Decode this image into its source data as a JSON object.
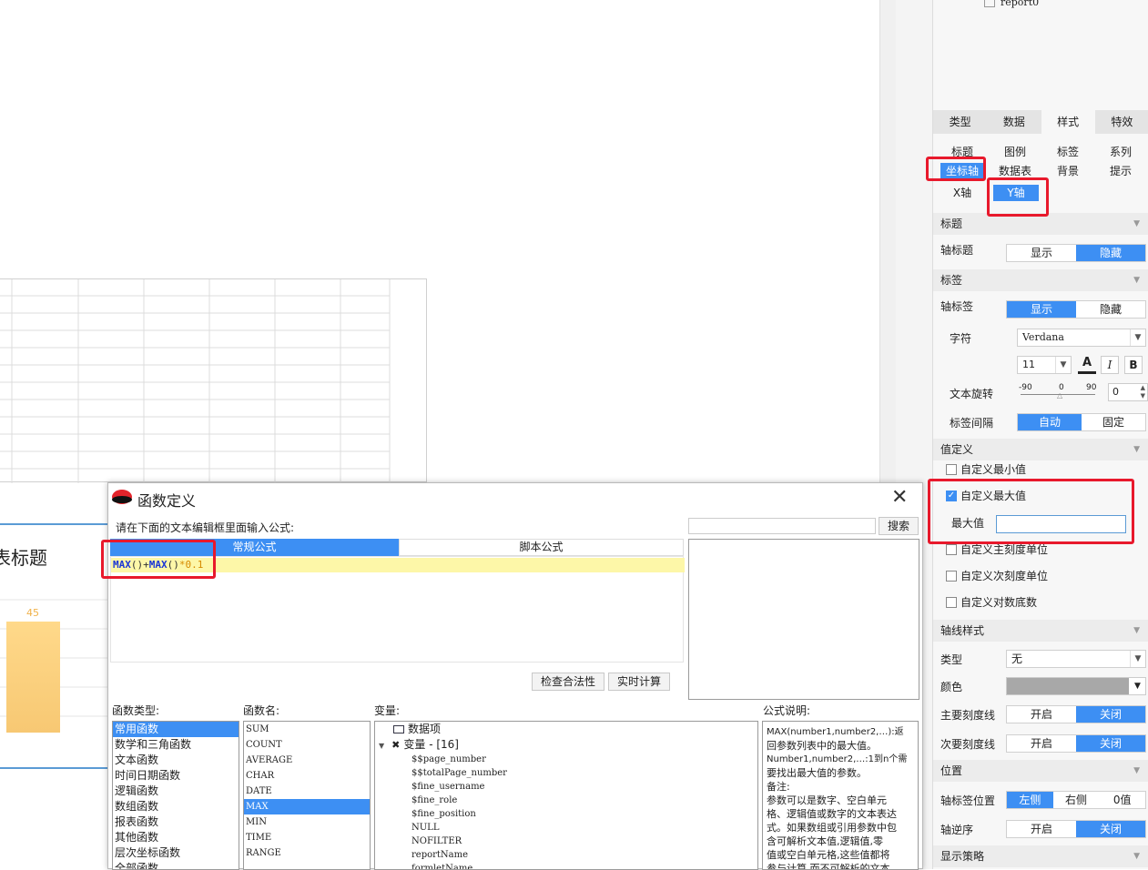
{
  "chart_preview": {
    "title": "表标题",
    "bar_label": "45",
    "bar_value": 45
  },
  "panel": {
    "tree_item": "report0",
    "main_tabs": [
      "类型",
      "数据",
      "样式",
      "特效"
    ],
    "sub_tabs_row1": [
      "标题",
      "图例",
      "标签",
      "系列"
    ],
    "sub_tabs_row2": [
      "坐标轴",
      "数据表",
      "背景",
      "提示"
    ],
    "axis_tabs": [
      "X轴",
      "Y轴"
    ],
    "sections": {
      "title": "标题",
      "label": "标签",
      "value_def": "值定义",
      "axis_style": "轴线样式",
      "position": "位置",
      "display_strategy": "显示策略"
    },
    "axis_title": {
      "label": "轴标题",
      "show": "显示",
      "hide": "隐藏"
    },
    "axis_label": {
      "label": "轴标签",
      "show": "显示",
      "hide": "隐藏"
    },
    "font": {
      "label": "字符",
      "family": "Verdana",
      "size": "11",
      "bold": "B",
      "italic": "I",
      "color": "A"
    },
    "rotation": {
      "label": "文本旋转",
      "min": "-90",
      "mid": "0",
      "max": "90",
      "value": "0"
    },
    "interval": {
      "label": "标签间隔",
      "auto": "自动",
      "fixed": "固定"
    },
    "custom_min": "自定义最小值",
    "custom_max": "自定义最大值",
    "max_value_label": "最大值",
    "max_value": "",
    "custom_major": "自定义主刻度单位",
    "custom_minor": "自定义次刻度单位",
    "custom_log": "自定义对数底数",
    "line_type": {
      "label": "类型",
      "value": "无"
    },
    "line_color": {
      "label": "颜色",
      "value": "#a8a8a8"
    },
    "major_tick": {
      "label": "主要刻度线",
      "on": "开启",
      "off": "关闭"
    },
    "minor_tick": {
      "label": "次要刻度线",
      "on": "开启",
      "off": "关闭"
    },
    "label_pos": {
      "label": "轴标签位置",
      "left": "左侧",
      "right": "右侧",
      "zero": "0值"
    },
    "reverse": {
      "label": "轴逆序",
      "on": "开启",
      "off": "关闭"
    }
  },
  "dialog": {
    "title": "函数定义",
    "instruction": "请在下面的文本编辑框里面输入公式:",
    "tab_normal": "常规公式",
    "tab_script": "脚本公式",
    "formula_max1": "MAX",
    "formula_p1": "()",
    "formula_plus": "+",
    "formula_max2": "MAX",
    "formula_p2": "()",
    "formula_tail": "*0.1",
    "search_btn": "搜索",
    "check_btn": "检查合法性",
    "calc_btn": "实时计算",
    "func_type_label": "函数类型:",
    "func_name_label": "函数名:",
    "var_label": "变量:",
    "desc_label": "公式说明:",
    "func_types": [
      "常用函数",
      "数学和三角函数",
      "文本函数",
      "时间日期函数",
      "逻辑函数",
      "数组函数",
      "报表函数",
      "其他函数",
      "层次坐标函数",
      "全部函数"
    ],
    "func_names": [
      "SUM",
      "COUNT",
      "AVERAGE",
      "CHAR",
      "DATE",
      "MAX",
      "MIN",
      "TIME",
      "RANGE"
    ],
    "var_root": "数据项",
    "var_group": "变量 - [16]",
    "variables": [
      "$$page_number",
      "$$totalPage_number",
      "$fine_username",
      "$fine_role",
      "$fine_position",
      "NULL",
      "NOFILTER",
      "reportName",
      "formletName"
    ],
    "desc_lines": [
      "MAX(number1,number2,…):返",
      "回参数列表中的最大值。",
      "Number1,number2,…:1到n个需",
      "要找出最大值的参数。",
      "备注:",
      "参数可以是数字、空白单元",
      "格、逻辑值或数字的文本表达",
      "式。如果数组或引用参数中包",
      "含可解析文本值,逻辑值,零",
      "值或空白单元格,这些值都将",
      "参与计算,而不可解析的文本"
    ]
  }
}
